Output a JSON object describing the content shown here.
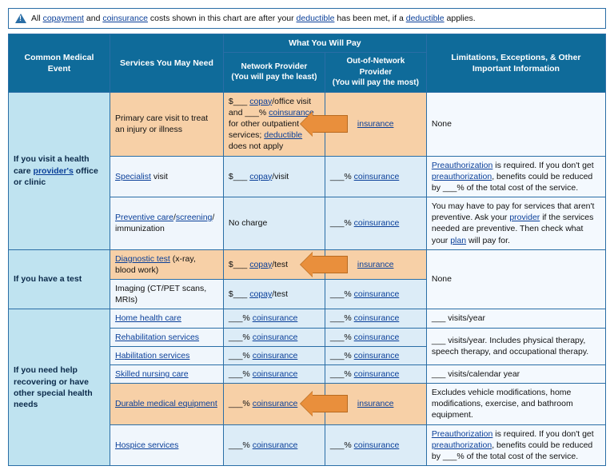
{
  "banner": {
    "prefix": "All ",
    "copay": "copayment",
    "mid1": " and ",
    "coins": "coinsurance",
    "mid2": " costs shown in this chart are after your ",
    "deductible1": "deductible",
    "mid3": " has been met, if a ",
    "deductible2": "deductible",
    "suffix": " applies."
  },
  "headers": {
    "event": "Common Medical Event",
    "services": "Services You May Need",
    "pay_group": "What You Will Pay",
    "network": "Network Provider",
    "network_sub": "(You will pay the least)",
    "oon": "Out-of-Network Provider",
    "oon_sub": "(You will pay the most)",
    "limits": "Limitations, Exceptions, & Other Important Information"
  },
  "events": {
    "visit": "If you visit a health care ",
    "visit_link": "provider's",
    "visit_after": " office or clinic",
    "test": "If you have a test",
    "recover": "If you need help recovering or have other special health needs"
  },
  "rows": {
    "primary": {
      "svc": "Primary care visit to treat an injury or illness",
      "net_pre": "$___ ",
      "net_copay": "copay",
      "net_mid1": "/office visit and ___% ",
      "net_coins": "coinsurance",
      "net_mid2": " for other outpatient services; ",
      "net_ded": "deductible",
      "net_end": " does not apply",
      "oon_link": "insurance",
      "lim": "None"
    },
    "specialist": {
      "svc_link": "Specialist",
      "svc_after": " visit",
      "net_pre": "$___ ",
      "net_copay": "copay",
      "net_after": "/visit",
      "oon_pre": "___% ",
      "oon_link": "coinsurance",
      "lim_link1": "Preauthorization",
      "lim_mid1": " is required. If you don't get ",
      "lim_link2": "preauthorization",
      "lim_mid2": ", benefits could be reduced by ___% of the total cost of the service."
    },
    "preventive": {
      "svc_link1": "Preventive care",
      "svc_slash": "/",
      "svc_link2": "screening",
      "svc_after": "/ immunization",
      "net": "No charge",
      "oon_pre": "___% ",
      "oon_link": "coinsurance",
      "lim_pre": "You may have to pay for services that aren't preventive. Ask your ",
      "lim_link1": "provider",
      "lim_mid": " if the services needed are preventive. Then check what your ",
      "lim_link2": "plan",
      "lim_end": " will pay for."
    },
    "diag": {
      "svc_link": "Diagnostic test",
      "svc_after": " (x-ray, blood work)",
      "net_pre": "$___ ",
      "net_copay": "copay",
      "net_after": "/test",
      "oon_link": "insurance",
      "lim": "None"
    },
    "imaging": {
      "svc": "Imaging (CT/PET scans, MRIs)",
      "net_pre": "$___ ",
      "net_copay": "copay",
      "net_after": "/test",
      "oon_pre": "___% ",
      "oon_link": "coinsurance"
    },
    "home": {
      "svc_link": "Home health care",
      "net_pre": "___% ",
      "net_link": "coinsurance",
      "oon_pre": "___% ",
      "oon_link": "coinsurance",
      "lim": "___ visits/year"
    },
    "rehab": {
      "svc_link": "Rehabilitation services",
      "net_pre": "___% ",
      "net_link": "coinsurance",
      "oon_pre": "___% ",
      "oon_link": "coinsurance",
      "lim": "___ visits/year. Includes physical therapy, speech therapy, and occupational therapy."
    },
    "habil": {
      "svc_link": "Habilitation services",
      "net_pre": "___% ",
      "net_link": "coinsurance",
      "oon_pre": "___% ",
      "oon_link": "coinsurance"
    },
    "skilled": {
      "svc_link": "Skilled nursing care",
      "net_pre": "___% ",
      "net_link": "coinsurance",
      "oon_pre": "___% ",
      "oon_link": "coinsurance",
      "lim": "___ visits/calendar year"
    },
    "dme": {
      "svc_link": "Durable medical equipment",
      "net_pre": "___% ",
      "net_link": "coinsurance",
      "oon_link": "insurance",
      "lim": "Excludes vehicle modifications, home modifications, exercise, and bathroom equipment."
    },
    "hospice": {
      "svc_link": "Hospice services",
      "net_pre": "___% ",
      "net_link": "coinsurance",
      "oon_pre": "___% ",
      "oon_link": "coinsurance",
      "lim_link1": "Preauthorization",
      "lim_mid1": " is required. If you don't get ",
      "lim_link2": "preauthorization",
      "lim_mid2": ", benefits could be reduced by ___% of the total cost of the service."
    }
  }
}
